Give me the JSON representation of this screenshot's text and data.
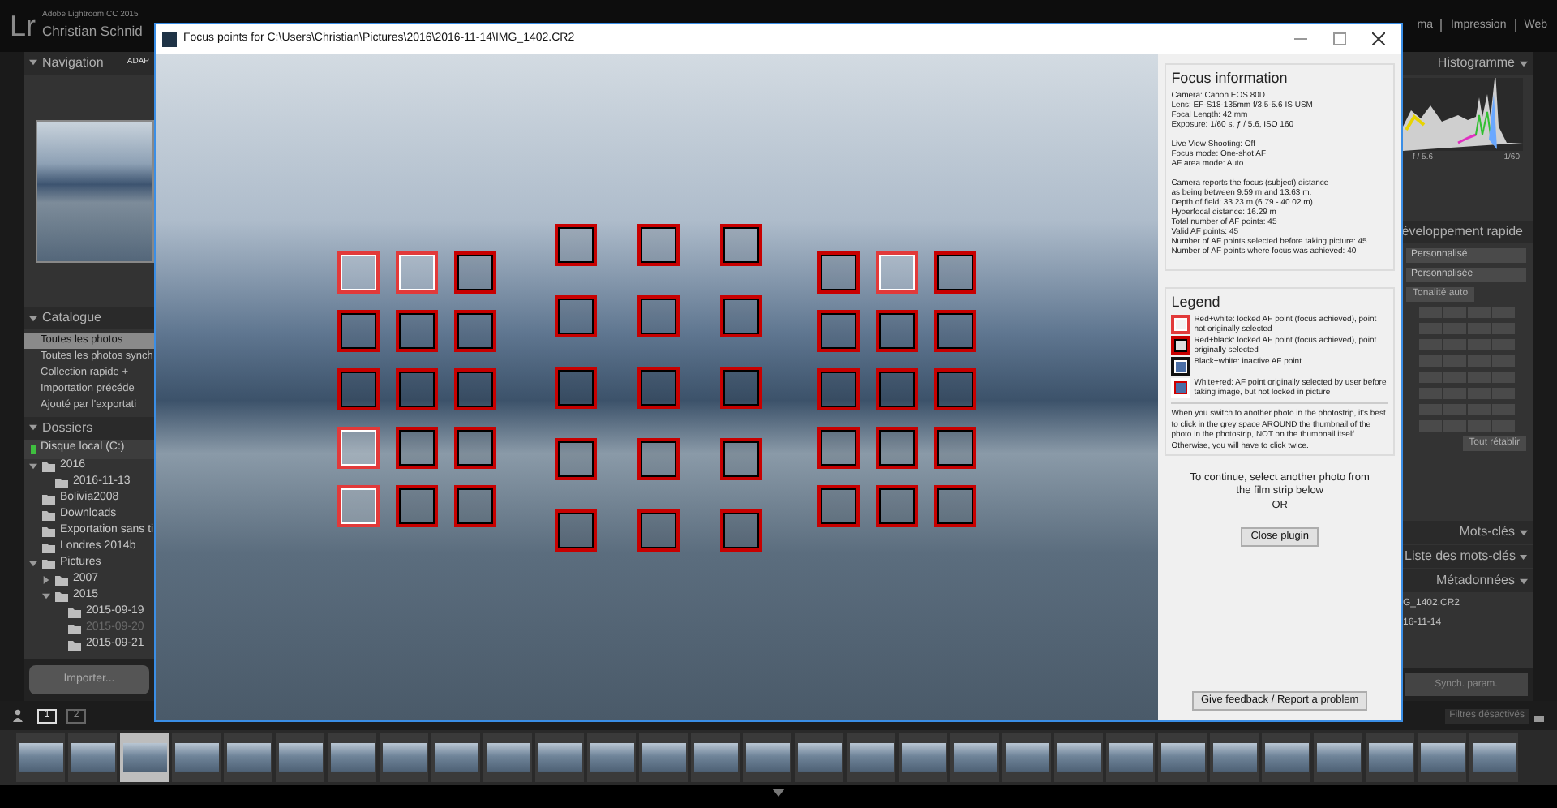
{
  "lightroom": {
    "logo": "Lr",
    "app_title": "Adobe Lightroom CC 2015",
    "user_name": "Christian Schnid",
    "modules": [
      "ma",
      "Impression",
      "Web"
    ],
    "navigation": {
      "title": "Navigation",
      "preset": "ADAP"
    },
    "catalogue": {
      "title": "Catalogue",
      "items": [
        {
          "label": "Toutes les photos",
          "selected": true
        },
        {
          "label": "Toutes les photos synch",
          "selected": false
        },
        {
          "label": "Collection rapide +",
          "selected": false
        },
        {
          "label": "Importation précéde",
          "selected": false
        },
        {
          "label": "Ajouté par l'exportati",
          "selected": false
        }
      ]
    },
    "folders": {
      "title": "Dossiers",
      "volume": "Disque local (C:)",
      "tree": [
        {
          "label": "2016",
          "expanded": true,
          "children": [
            {
              "label": "2016-11-13"
            }
          ]
        },
        {
          "label": "Bolivia2008"
        },
        {
          "label": "Downloads"
        },
        {
          "label": "Exportation sans ti"
        },
        {
          "label": "Londres 2014b"
        },
        {
          "label": "Pictures",
          "expanded": true,
          "children": [
            {
              "label": "2007",
              "expanded": false
            },
            {
              "label": "2015",
              "expanded": true,
              "children": [
                {
                  "label": "2015-09-19",
                  "dimmed": false
                },
                {
                  "label": "2015-09-20",
                  "dimmed": true
                },
                {
                  "label": "2015-09-21",
                  "dimmed": false
                }
              ]
            }
          ]
        }
      ]
    },
    "import_button": "Importer...",
    "pages": [
      {
        "label": "1",
        "selected": true
      },
      {
        "label": "2",
        "selected": false
      }
    ],
    "histogram": {
      "title": "Histogramme",
      "readings": [
        "f / 5.6",
        "1/60"
      ]
    },
    "quick_develop": {
      "title": "éveloppement rapide",
      "presets": [
        "Personnalisé",
        "Personnalisée"
      ],
      "auto_button": "Tonalité auto",
      "reset_button": "Tout rétablir"
    },
    "panels": [
      "Mots-clés",
      "Liste des mots-clés",
      "Métadonnées"
    ],
    "metadata_values": [
      "G_1402.CR2",
      "16-11-14"
    ],
    "sync_button": "Synch. param.",
    "filter": "Filtres désactivés",
    "filmstrip": [
      {
        "selected": false
      },
      {
        "selected": false
      },
      {
        "selected": true
      },
      {
        "selected": false
      },
      {
        "selected": false
      },
      {
        "selected": false
      },
      {
        "selected": false
      },
      {
        "selected": false
      },
      {
        "selected": false
      },
      {
        "selected": false
      },
      {
        "selected": false
      },
      {
        "selected": false
      },
      {
        "selected": false
      },
      {
        "selected": false
      },
      {
        "selected": false
      },
      {
        "selected": false
      },
      {
        "selected": false
      },
      {
        "selected": false
      },
      {
        "selected": false
      },
      {
        "selected": false
      },
      {
        "selected": false
      },
      {
        "selected": false
      },
      {
        "selected": false
      },
      {
        "selected": false
      },
      {
        "selected": false
      },
      {
        "selected": false
      },
      {
        "selected": false
      },
      {
        "selected": false
      },
      {
        "selected": false
      }
    ]
  },
  "dialog": {
    "title": "Focus points for C:\\Users\\Christian\\Pictures\\2016\\2016-11-14\\IMG_1402.CR2",
    "af_clusters": [
      {
        "points": [
          {
            "kind": "red_white"
          },
          {
            "kind": "red_white"
          },
          {
            "kind": "red_black"
          },
          {
            "kind": "red_black"
          },
          {
            "kind": "red_black"
          },
          {
            "kind": "red_black"
          },
          {
            "kind": "red_black"
          },
          {
            "kind": "red_black"
          },
          {
            "kind": "red_black"
          },
          {
            "kind": "red_white"
          },
          {
            "kind": "red_black"
          },
          {
            "kind": "red_black"
          },
          {
            "kind": "red_white"
          },
          {
            "kind": "red_black"
          },
          {
            "kind": "red_black"
          }
        ]
      },
      {
        "points": [
          {
            "kind": "red_black"
          },
          {
            "kind": "red_black"
          },
          {
            "kind": "red_black"
          },
          {
            "kind": "red_black"
          },
          {
            "kind": "red_black"
          },
          {
            "kind": "red_black"
          },
          {
            "kind": "red_black"
          },
          {
            "kind": "red_black"
          },
          {
            "kind": "red_black"
          },
          {
            "kind": "red_black"
          },
          {
            "kind": "red_black"
          },
          {
            "kind": "red_black"
          },
          {
            "kind": "red_black"
          },
          {
            "kind": "red_black"
          },
          {
            "kind": "red_black"
          }
        ]
      },
      {
        "points": [
          {
            "kind": "red_black"
          },
          {
            "kind": "red_white"
          },
          {
            "kind": "red_black"
          },
          {
            "kind": "red_black"
          },
          {
            "kind": "red_black"
          },
          {
            "kind": "red_black"
          },
          {
            "kind": "red_black"
          },
          {
            "kind": "red_black"
          },
          {
            "kind": "red_black"
          },
          {
            "kind": "red_black"
          },
          {
            "kind": "red_black"
          },
          {
            "kind": "red_black"
          },
          {
            "kind": "red_black"
          },
          {
            "kind": "red_black"
          },
          {
            "kind": "red_black"
          }
        ]
      }
    ],
    "focus_info": {
      "title": "Focus information",
      "groups": [
        [
          "Camera: Canon EOS 80D",
          "Lens: EF-S18-135mm f/3.5-5.6 IS USM",
          "Focal Length: 42 mm",
          "Exposure: 1/60 s, ƒ / 5.6, ISO 160"
        ],
        [
          "Live View Shooting: Off",
          "Focus mode: One-shot AF",
          "AF area mode: Auto"
        ],
        [
          "Camera reports the focus (subject) distance",
          "as being between 9.59 m and 13.63 m.",
          "Depth of field: 33.23 m (6.79 - 40.02 m)",
          "Hyperfocal distance: 16.29 m",
          "Total number of AF points: 45",
          "Valid AF points: 45",
          "Number of AF points selected before taking picture: 45",
          "Number of AF points where focus was achieved: 40"
        ]
      ]
    },
    "legend": {
      "title": "Legend",
      "items": [
        {
          "kind": "red_white",
          "text": "Red+white: locked AF point (focus achieved), point not originally selected"
        },
        {
          "kind": "red_black",
          "text": "Red+black: locked AF point (focus achieved), point originally selected"
        },
        {
          "kind": "black_white",
          "text": "Black+white: inactive AF point"
        },
        {
          "kind": "white_red",
          "text": "White+red: AF point originally selected by user before taking image, but not locked in picture"
        }
      ],
      "note": "When you switch to another photo in the photostrip, it's best to click in the grey space AROUND the thumbnail of the photo in the photostrip, NOT on the thumbnail itself. Otherwise, you will have to click twice."
    },
    "continue_text": "To continue, select another photo from the film strip below",
    "or_text": "OR",
    "close_button": "Close plugin",
    "feedback_button": "Give feedback / Report a problem"
  }
}
